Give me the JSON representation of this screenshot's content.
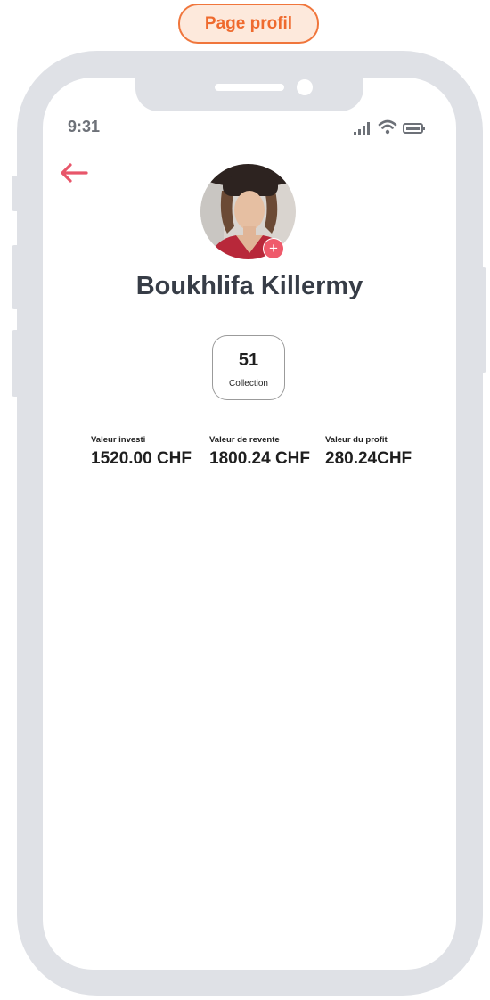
{
  "page_label": "Page profil",
  "status_bar": {
    "time": "9:31"
  },
  "profile": {
    "name": "Boukhlifa Killermy"
  },
  "collection": {
    "count": "51",
    "label": "Collection"
  },
  "stats": [
    {
      "label": "Valeur investi",
      "value": "1520.00 CHF"
    },
    {
      "label": "Valeur de revente",
      "value": "1800.24 CHF"
    },
    {
      "label": "Valeur du profit",
      "value": "280.24CHF"
    }
  ],
  "colors": {
    "accent": "#ef5a6b",
    "label_orange": "#f0763c",
    "frame": "#dfe1e6",
    "text": "#373d47"
  },
  "icons": [
    "back-arrow-icon",
    "signal-icon",
    "wifi-icon",
    "battery-icon",
    "plus-icon"
  ]
}
